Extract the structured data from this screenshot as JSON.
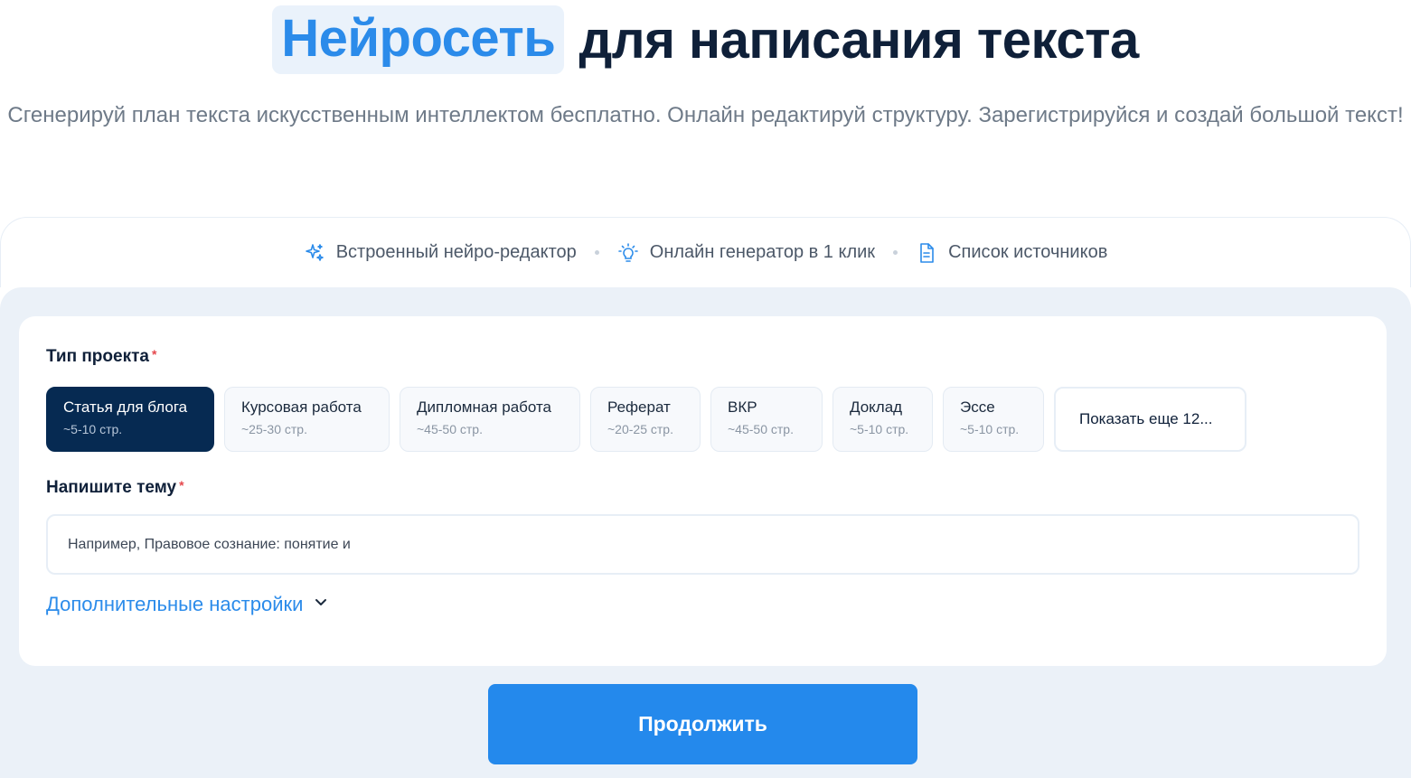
{
  "hero": {
    "title_highlight": "Нейросеть",
    "title_rest": "для написания текста",
    "subtitle": "Сгенерируй план текста искусственным интеллектом бесплатно. Онлайн редактируй структуру. Зарегистрируйся и создай большой текст!"
  },
  "features": [
    {
      "label": "Встроенный нейро-редактор",
      "icon": "sparkles-icon"
    },
    {
      "label": "Онлайн генератор в 1 клик",
      "icon": "lightbulb-icon"
    },
    {
      "label": "Список источников",
      "icon": "document-icon"
    }
  ],
  "form": {
    "project_type_label": "Тип проекта",
    "required_mark": "*",
    "project_types": [
      {
        "title": "Статья для блога",
        "pages": "~5-10 стр.",
        "selected": true
      },
      {
        "title": "Курсовая работа",
        "pages": "~25-30 стр.",
        "selected": false
      },
      {
        "title": "Дипломная работа",
        "pages": "~45-50 стр.",
        "selected": false
      },
      {
        "title": "Реферат",
        "pages": "~20-25 стр.",
        "selected": false
      },
      {
        "title": "ВКР",
        "pages": "~45-50 стр.",
        "selected": false
      },
      {
        "title": "Доклад",
        "pages": "~5-10 стр.",
        "selected": false
      },
      {
        "title": "Эссе",
        "pages": "~5-10 стр.",
        "selected": false
      }
    ],
    "show_more_label": "Показать еще 12...",
    "topic_label": "Напишите тему",
    "topic_placeholder": "Например, Правовое сознание: понятие и",
    "topic_value": "",
    "advanced_settings_label": "Дополнительные настройки",
    "continue_label": "Продолжить"
  },
  "colors": {
    "accent": "#2489ec",
    "dark": "#062a52",
    "panel_bg": "#ebf1f8",
    "required": "#e5484d"
  }
}
